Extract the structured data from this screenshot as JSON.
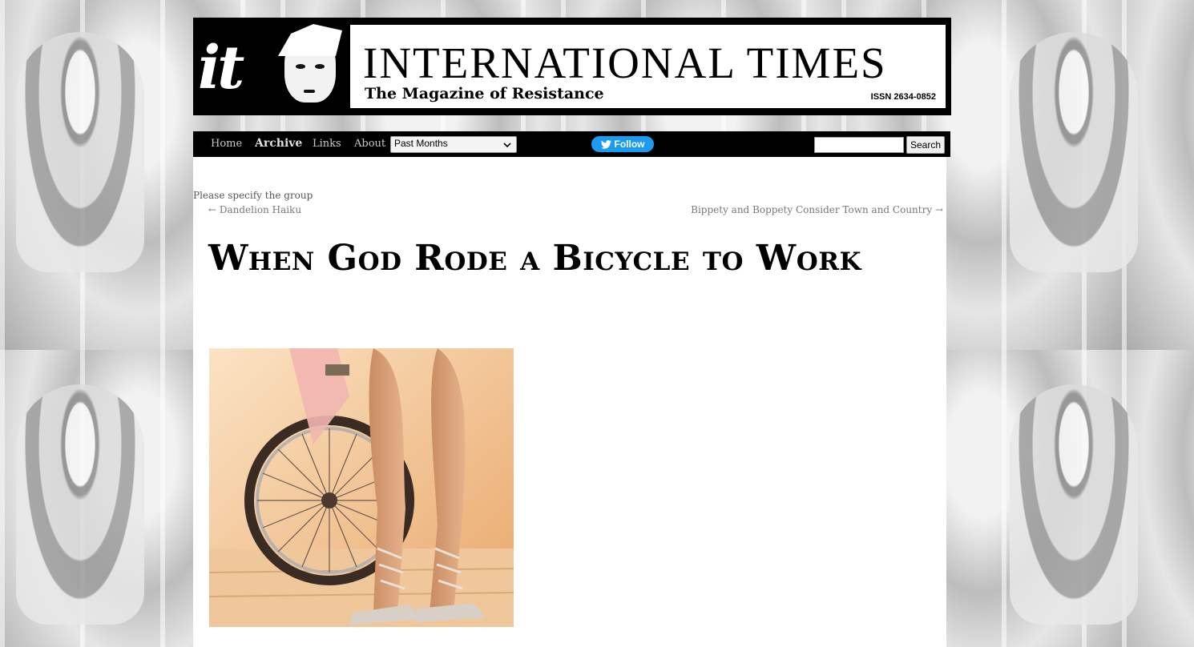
{
  "masthead": {
    "logo": "it",
    "site_title": "INTERNATIONAL TIMES",
    "tagline": "The Magazine of Resistance",
    "issn": "ISSN 2634-0852"
  },
  "nav": {
    "items": [
      {
        "label": "Home",
        "active": false
      },
      {
        "label": "Archive",
        "active": true
      },
      {
        "label": "Links",
        "active": false
      },
      {
        "label": "About",
        "active": false
      }
    ],
    "archive_select": {
      "value": "Past Months"
    },
    "follow_button": "Follow",
    "search_button": "Search",
    "search_value": ""
  },
  "post": {
    "notice": "Please specify the group",
    "prev_link": "← Dandelion Haiku",
    "next_link": "Bippety and Boppety Consider Town and Country →",
    "title": "When God Rode a Bicycle to Work"
  },
  "colors": {
    "masthead_bg": "#000000",
    "nav_bg": "#000000",
    "follow_blue": "#1d9bf0",
    "content_bg": "#ffffff"
  },
  "icons": [
    "twitter-bird-icon",
    "chevron-down-icon"
  ]
}
